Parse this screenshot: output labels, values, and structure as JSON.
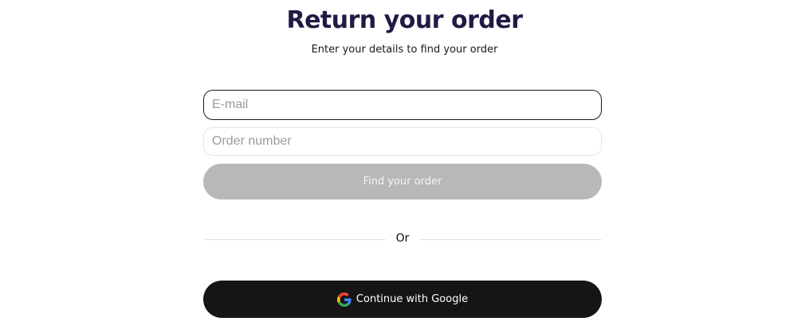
{
  "header": {
    "title": "Return your order",
    "subtitle": "Enter your details to find your order"
  },
  "form": {
    "email_placeholder": "E-mail",
    "email_value": "",
    "order_placeholder": "Order number",
    "order_value": "",
    "submit_label": "Find your order"
  },
  "divider": {
    "label": "Or"
  },
  "social": {
    "google_label": "Continue with Google",
    "icon": "google-icon"
  },
  "colors": {
    "title": "#231942",
    "button_disabled": "#b8b8b8",
    "google_button_bg": "#151515"
  }
}
